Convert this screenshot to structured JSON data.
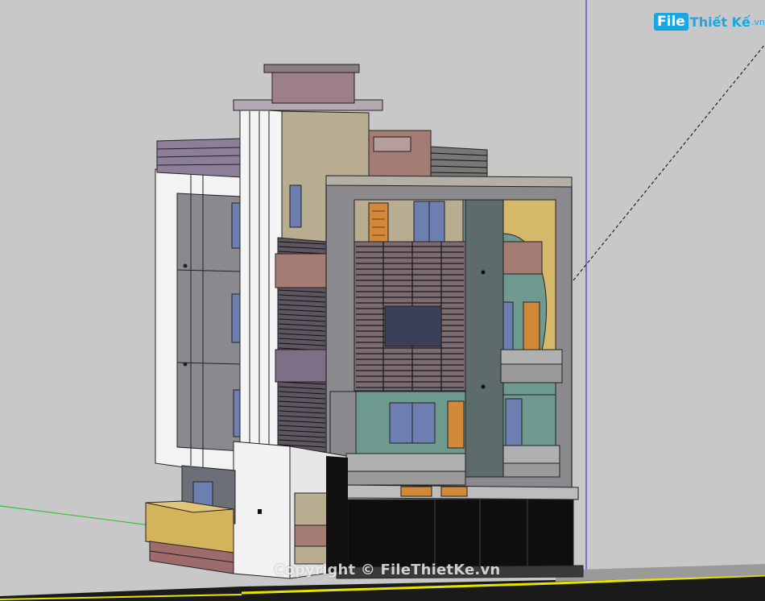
{
  "image": {
    "subject": "3D SketchUp model of a multi-storey townhouse viewed in perspective",
    "background_color": "#c8c8c8"
  },
  "logo": {
    "badge": "File",
    "rest": "Thiết Kế",
    "tld": ".vn"
  },
  "watermark": "Copyright © FileThietKe.vn",
  "colors": {
    "facade_grey": "#8a8a8e",
    "wall_white": "#f2f2f2",
    "teal_wall": "#6f9a8f",
    "beige_wall": "#b8ad91",
    "mauve_roof": "#9c7f88",
    "brown_block": "#a57c73",
    "door_orange": "#d28a3a",
    "window_blue": "#6d7fb0",
    "garage_black": "#0e0e0e",
    "balcony_yellow": "#d4b45a",
    "road_line_yellow": "#e8e400",
    "axis_blue": "#3b3bd9",
    "axis_green": "#3cbf3c"
  }
}
